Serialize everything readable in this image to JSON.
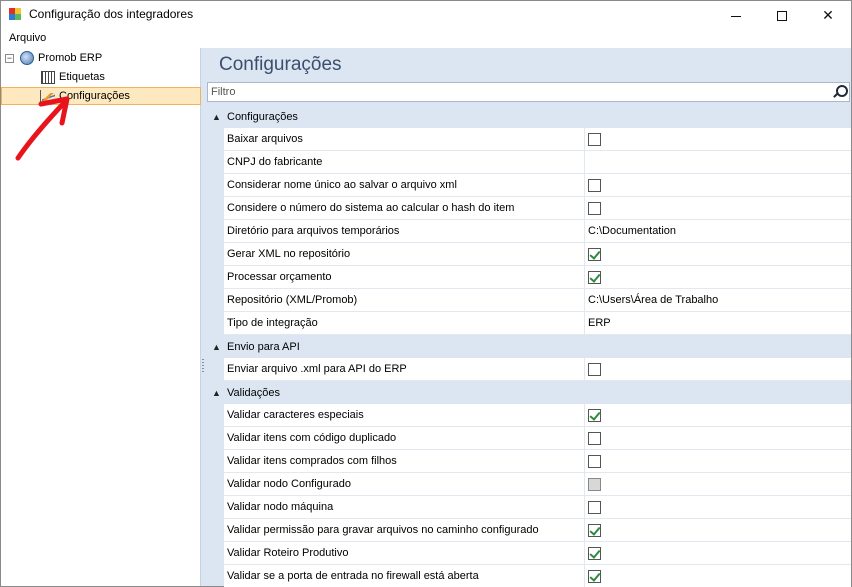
{
  "window": {
    "title": "Configuração dos integradores",
    "minimize_glyph": "—",
    "close_glyph": "✕"
  },
  "menu": {
    "file": "Arquivo"
  },
  "tree": {
    "root": {
      "label": "Promob ERP",
      "expander": "−",
      "icon": "globe-icon"
    },
    "items": [
      {
        "label": "Etiquetas",
        "icon": "barcode-tag-icon"
      },
      {
        "label": "Configurações",
        "icon": "chart-settings-icon",
        "selected": true
      }
    ]
  },
  "panel": {
    "title": "Configurações",
    "filter_placeholder": "Filtro"
  },
  "sections": [
    {
      "label": "Configurações",
      "collapse_glyph": "▲",
      "rows": [
        {
          "name": "Baixar arquivos",
          "type": "checkbox",
          "checked": false
        },
        {
          "name": "CNPJ do fabricante",
          "type": "text",
          "value": ""
        },
        {
          "name": "Considerar nome único ao salvar o arquivo xml",
          "type": "checkbox",
          "checked": false
        },
        {
          "name": "Considere o número do sistema ao calcular o hash do item",
          "type": "checkbox",
          "checked": false
        },
        {
          "name": "Diretório para arquivos temporários",
          "type": "text",
          "value": "C:\\Documentation"
        },
        {
          "name": "Gerar XML no repositório",
          "type": "checkbox",
          "checked": true
        },
        {
          "name": "Processar orçamento",
          "type": "checkbox",
          "checked": true
        },
        {
          "name": "Repositório (XML/Promob)",
          "type": "text",
          "value": "C:\\Users\\Área de Trabalho"
        },
        {
          "name": "Tipo de integração",
          "type": "text",
          "value": "ERP"
        }
      ]
    },
    {
      "label": "Envio para API",
      "collapse_glyph": "▲",
      "rows": [
        {
          "name": "Enviar arquivo .xml para API do ERP",
          "type": "checkbox",
          "checked": false
        }
      ]
    },
    {
      "label": "Validações",
      "collapse_glyph": "▲",
      "rows": [
        {
          "name": "Validar caracteres especiais",
          "type": "checkbox",
          "checked": true
        },
        {
          "name": "Validar itens com código duplicado",
          "type": "checkbox",
          "checked": false
        },
        {
          "name": "Validar itens comprados com filhos",
          "type": "checkbox",
          "checked": false
        },
        {
          "name": "Validar nodo Configurado",
          "type": "checkbox",
          "checked": false,
          "disabled": true
        },
        {
          "name": "Validar nodo máquina",
          "type": "checkbox",
          "checked": false
        },
        {
          "name": "Validar permissão para gravar arquivos no caminho configurado",
          "type": "checkbox",
          "checked": true
        },
        {
          "name": "Validar Roteiro Produtivo",
          "type": "checkbox",
          "checked": true
        },
        {
          "name": "Validar se a porta de entrada no firewall está aberta",
          "type": "checkbox",
          "checked": true
        }
      ]
    }
  ],
  "colors": {
    "accent_panel": "#dce6f3",
    "selection_fill": "#fde8c0",
    "selection_border": "#f0b35a",
    "check_green": "#2d8a3e",
    "annotation_arrow": "#e8141c"
  }
}
